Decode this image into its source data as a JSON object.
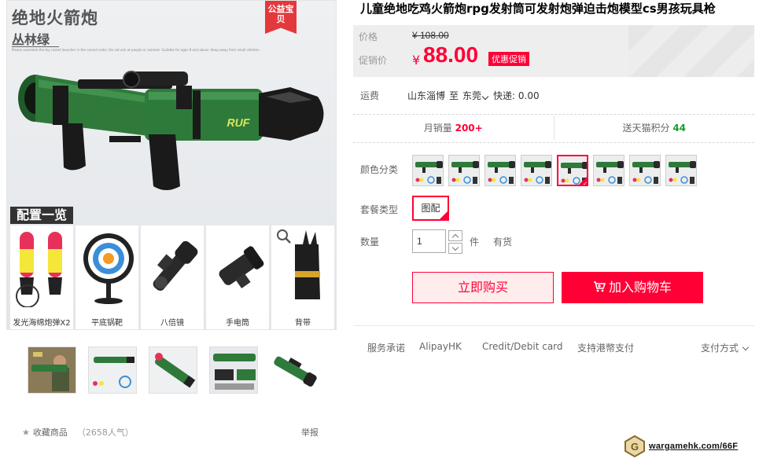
{
  "product_image": {
    "title": "绝地火箭炮",
    "subtitle": "丛林绿",
    "fine_print": "Please assemble the toy rocket launcher in the correct order. Do not aim at people or animals. Suitable for ages 8 and above. Keep away from small children.",
    "charity_tag": "公益宝贝",
    "config_banner": "配置一览",
    "config_items": [
      {
        "label": "发光海绵炮弹X2"
      },
      {
        "label": "平底锅靶"
      },
      {
        "label": "八倍镜"
      },
      {
        "label": "手电筒"
      },
      {
        "label": "背带"
      }
    ]
  },
  "gallery": {
    "thumbnail_count": 5
  },
  "favorite": {
    "label": "收藏商品",
    "count": "（2658人气）"
  },
  "report": "举报",
  "product": {
    "title": "儿童绝地吃鸡火箭炮rpg发射筒可发射炮弹迫击炮模型cs男孩玩具枪"
  },
  "price": {
    "original_label": "价格",
    "original_value": "¥ 108.00",
    "promo_label": "促销价",
    "currency": "¥",
    "promo_value": "88.00",
    "promo_badge": "优惠促销"
  },
  "shipping": {
    "label": "运费",
    "from": "山东淄博",
    "to_word": "至",
    "to": "东莞",
    "express": "快递: 0.00"
  },
  "stats": {
    "sales_label": "月销量",
    "sales_value": "200+",
    "points_label": "送天猫积分",
    "points_value": "44"
  },
  "options": {
    "color_label": "颜色分类",
    "swatch_count": 8,
    "selected_swatch_index": 4,
    "package_label": "套餐类型",
    "package_value": "图配"
  },
  "quantity": {
    "label": "数量",
    "value": "1",
    "unit": "件",
    "stock": "有货"
  },
  "buttons": {
    "buy_now": "立即购买",
    "add_to_cart": "加入购物车"
  },
  "services": {
    "label": "服务承诺",
    "items": [
      "AlipayHK",
      "Credit/Debit card",
      "支持港幣支付"
    ],
    "payment_label": "支付方式"
  },
  "watermark": "wargamehk.com/66F",
  "colors": {
    "accent": "#ff0036",
    "launcher_green": "#2f7a3b",
    "launcher_dark": "#2a2a2a"
  }
}
